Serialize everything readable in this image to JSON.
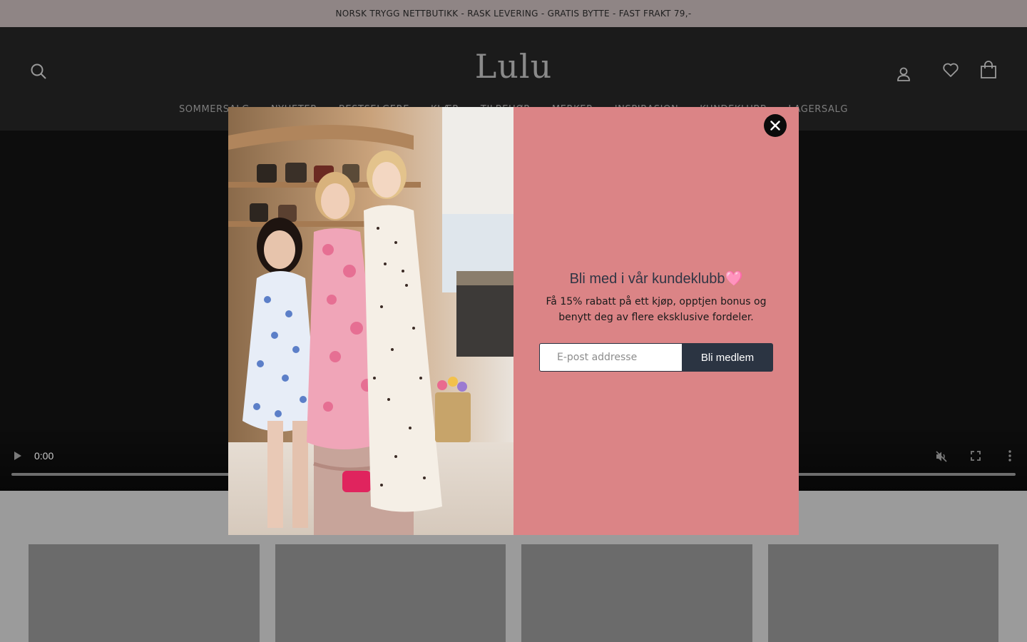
{
  "announcement": {
    "text": "NORSK TRYGG NETTBUTIKK - RASK LEVERING - GRATIS BYTTE - FAST FRAKT 79,-"
  },
  "header": {
    "logo_text": "Lulu",
    "icons": {
      "search": "search-icon",
      "account": "user-icon",
      "wishlist": "heart-icon",
      "cart": "bag-icon"
    }
  },
  "nav": {
    "items": [
      {
        "label": "SOMMERSALG"
      },
      {
        "label": "NYHETER"
      },
      {
        "label": "BESTSELGERE"
      },
      {
        "label": "KLÆR"
      },
      {
        "label": "TILBEHØR"
      },
      {
        "label": "MERKER"
      },
      {
        "label": "INSPIRASJON"
      },
      {
        "label": "KUNDEKLUBB"
      },
      {
        "label": "LAGERSALG"
      }
    ]
  },
  "video": {
    "time": "0:00"
  },
  "popup": {
    "title": "Bli med i vår kundeklubb🩷",
    "subtitle": "Få 15% rabatt på ett kjøp, opptjen bonus og benytt deg av flere eksklusive fordeler.",
    "email_placeholder": "E-post addresse",
    "submit_label": "Bli medlem",
    "panel_color": "#db8486",
    "button_color": "#2b3442"
  }
}
